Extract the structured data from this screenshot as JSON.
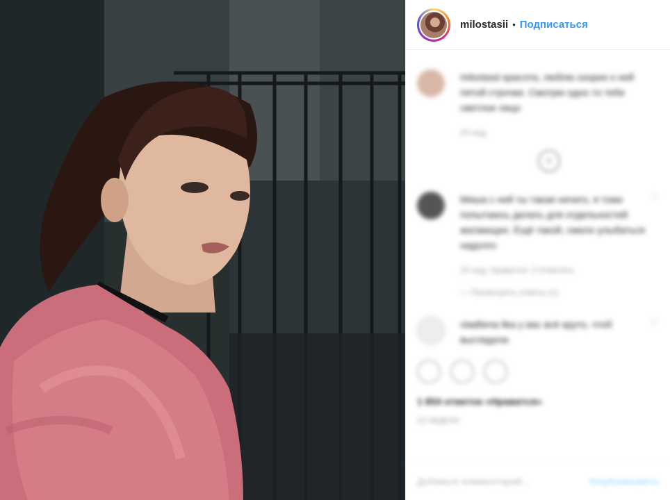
{
  "post": {
    "username": "milostasii",
    "separator": "•",
    "follow_label": "Подписаться"
  },
  "blurred_comments": [
    {
      "text": "milostasii красота, люблю скорее к ней пятой строчки. Смотрю одно то тебе светлое лицо",
      "meta": "23 нед."
    },
    {
      "text": "Миша с ней ты такая ничего, я тоже попытаюсь делать для отдельностей желающих. Ещё такой, смело улыбаться надолго",
      "meta": "23 нед.   Нравится: 2   Ответить"
    },
    {
      "text": "— Посмотреть ответы (1)",
      "meta": ""
    },
    {
      "text": "vladilena lika у вас всё круто, чтоб выглядели",
      "meta": ""
    }
  ],
  "likes_text": "1 854 отметок «Нравится»",
  "date_text": "23 НЕДЕЛИ",
  "comment_placeholder": "Добавьте комментарий...",
  "publish_label": "Опубликовать",
  "colors": {
    "accent": "#3897f0",
    "text": "#262626",
    "muted": "#999999"
  },
  "icons": [
    "heart-icon",
    "comment-icon",
    "share-icon",
    "bookmark-icon"
  ]
}
